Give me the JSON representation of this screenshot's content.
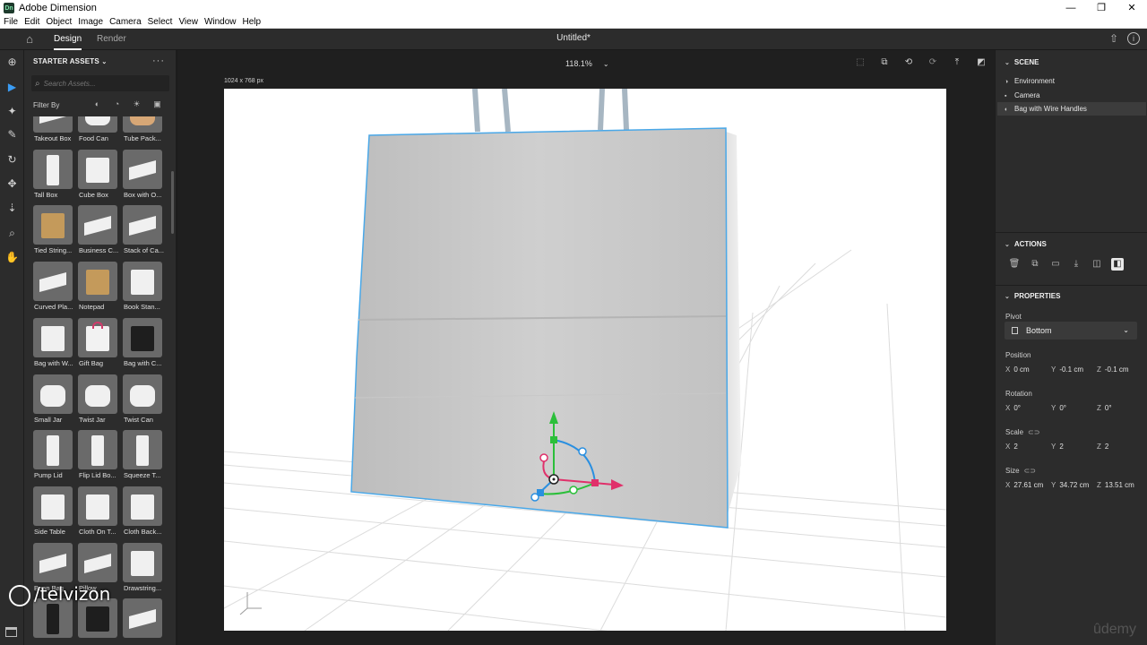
{
  "window": {
    "title": "Adobe Dimension",
    "app_icon": "Dn",
    "controls": [
      "—",
      "❐",
      "✕"
    ]
  },
  "menu": [
    "File",
    "Edit",
    "Object",
    "Image",
    "Camera",
    "Select",
    "View",
    "Window",
    "Help"
  ],
  "appbar": {
    "tabs": [
      {
        "label": "Design",
        "active": true
      },
      {
        "label": "Render",
        "active": false
      }
    ],
    "document_title": "Untitled*"
  },
  "assets_panel": {
    "header": "STARTER ASSETS",
    "search_placeholder": "Search Assets...",
    "filter_label": "Filter By",
    "items": [
      {
        "label": "Takeout Box",
        "icon": "takeout-box"
      },
      {
        "label": "Food Can",
        "icon": "food-can"
      },
      {
        "label": "Tube Pack...",
        "icon": "tube-pack"
      },
      {
        "label": "Tall Box",
        "icon": "tall-box"
      },
      {
        "label": "Cube Box",
        "icon": "cube-box"
      },
      {
        "label": "Box with O...",
        "icon": "box-open"
      },
      {
        "label": "Tied String...",
        "icon": "tied-string"
      },
      {
        "label": "Business C...",
        "icon": "business-card"
      },
      {
        "label": "Stack of Ca...",
        "icon": "card-stack"
      },
      {
        "label": "Curved Pla...",
        "icon": "curved-plane"
      },
      {
        "label": "Notepad",
        "icon": "notepad"
      },
      {
        "label": "Book Stan...",
        "icon": "book-stand"
      },
      {
        "label": "Bag with W...",
        "icon": "bag-white"
      },
      {
        "label": "Gift Bag",
        "icon": "gift-bag"
      },
      {
        "label": "Bag with C...",
        "icon": "bag-black"
      },
      {
        "label": "Small Jar",
        "icon": "small-jar"
      },
      {
        "label": "Twist Jar",
        "icon": "twist-jar"
      },
      {
        "label": "Twist Can",
        "icon": "twist-can"
      },
      {
        "label": "Pump Lid",
        "icon": "pump-lid"
      },
      {
        "label": "Flip Lid Bo...",
        "icon": "flip-lid"
      },
      {
        "label": "Squeeze T...",
        "icon": "squeeze-tube"
      },
      {
        "label": "Side Table",
        "icon": "side-table"
      },
      {
        "label": "Cloth On T...",
        "icon": "cloth-table"
      },
      {
        "label": "Cloth Back...",
        "icon": "cloth-back"
      },
      {
        "label": "Bean Bag",
        "icon": "bean-bag"
      },
      {
        "label": "Pillow",
        "icon": "pillow"
      },
      {
        "label": "Drawstring...",
        "icon": "drawstring"
      },
      {
        "label": "",
        "icon": "phone"
      },
      {
        "label": "",
        "icon": "tablet"
      },
      {
        "label": "",
        "icon": "laptop"
      }
    ]
  },
  "canvas": {
    "zoom": "118.1%",
    "dimensions": "1024 x 768 px"
  },
  "scene": {
    "header": "SCENE",
    "items": [
      {
        "label": "Environment",
        "icon": "environment-icon",
        "selected": false
      },
      {
        "label": "Camera",
        "icon": "camera-icon",
        "selected": false
      },
      {
        "label": "Bag with Wire Handles",
        "icon": "model-icon",
        "selected": true
      }
    ]
  },
  "actions": {
    "header": "ACTIONS"
  },
  "properties": {
    "header": "PROPERTIES",
    "pivot": {
      "label": "Pivot",
      "value": "Bottom"
    },
    "position": {
      "label": "Position",
      "x": "0 cm",
      "y": "-0.1 cm",
      "z": "-0.1 cm"
    },
    "rotation": {
      "label": "Rotation",
      "x": "0°",
      "y": "0°",
      "z": "0°"
    },
    "scale": {
      "label": "Scale",
      "x": "2",
      "y": "2",
      "z": "2"
    },
    "size": {
      "label": "Size",
      "x": "27.61 cm",
      "y": "34.72 cm",
      "z": "13.51 cm"
    }
  },
  "watermarks": {
    "left": "/telvizon",
    "right": "ûdemy"
  },
  "colors": {
    "accent": "#3a9cf4",
    "panel": "#2c2c2c",
    "selection_outline": "#4aa8e8"
  }
}
